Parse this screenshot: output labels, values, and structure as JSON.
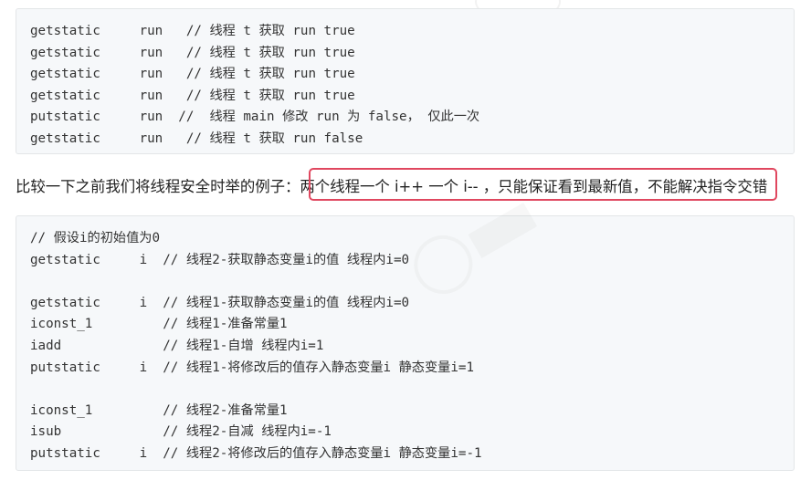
{
  "block1": {
    "lines": [
      "getstatic     run   // 线程 t 获取 run true",
      "getstatic     run   // 线程 t 获取 run true",
      "getstatic     run   // 线程 t 获取 run true",
      "getstatic     run   // 线程 t 获取 run true",
      "putstatic     run  //  线程 main 修改 run 为 false， 仅此一次",
      "getstatic     run   // 线程 t 获取 run false"
    ]
  },
  "paragraph": {
    "prefix": "比较一下之前我们将线程安全时举的例子：",
    "highlighted": "两个线程一个 i++ 一个 i-- ，只能保证看到最新值，不能解决指令交错"
  },
  "block2": {
    "lines": [
      "// 假设i的初始值为0",
      "getstatic     i  // 线程2-获取静态变量i的值 线程内i=0",
      "",
      "getstatic     i  // 线程1-获取静态变量i的值 线程内i=0",
      "iconst_1         // 线程1-准备常量1",
      "iadd             // 线程1-自增 线程内i=1",
      "putstatic     i  // 线程1-将修改后的值存入静态变量i 静态变量i=1",
      "",
      "iconst_1         // 线程2-准备常量1",
      "isub             // 线程2-自减 线程内i=-1",
      "putstatic     i  // 线程2-将修改后的值存入静态变量i 静态变量i=-1"
    ]
  },
  "colors": {
    "code_background": "#f6f8fa",
    "highlight_border": "#e0475f",
    "text": "#333333"
  }
}
